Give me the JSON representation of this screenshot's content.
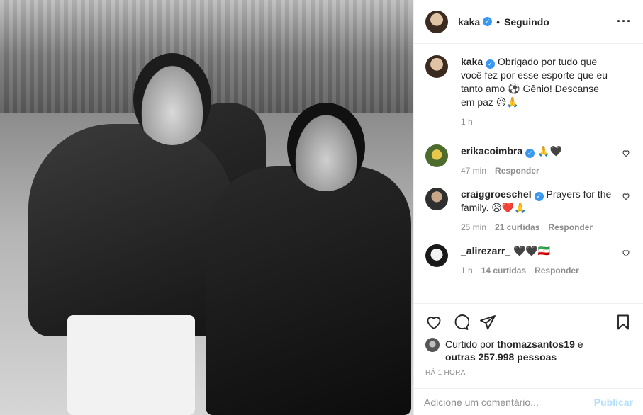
{
  "header": {
    "username": "kaka",
    "separator": "•",
    "follow_status": "Seguindo",
    "more_icon": "more-horizontal-icon"
  },
  "caption": {
    "username": "kaka",
    "text": "Obrigado por tudo que você fez por esse esporte que eu tanto amo ⚽ Gênio! Descanse em paz 😥🙏",
    "time": "1 h"
  },
  "comments": [
    {
      "username": "erikacoimbra",
      "verified": true,
      "text": "🙏🖤",
      "time": "47 min",
      "likes": "",
      "reply": "Responder"
    },
    {
      "username": "craiggroeschel",
      "verified": true,
      "text": "Prayers for the family. 😥❤️🙏",
      "time": "25 min",
      "likes": "21 curtidas",
      "reply": "Responder"
    },
    {
      "username": "_alirezarr_",
      "verified": false,
      "text": "🖤🖤🇮🇷",
      "time": "1 h",
      "likes": "14 curtidas",
      "reply": "Responder"
    }
  ],
  "actions": {
    "like_icon": "heart-icon",
    "comment_icon": "comment-icon",
    "share_icon": "send-icon",
    "save_icon": "bookmark-icon"
  },
  "likes": {
    "prefix": "Curtido por",
    "user": "thomazsantos19",
    "middle": "e",
    "others": "outras 257.998 pessoas"
  },
  "time_ago": "HÁ 1 HORA",
  "add_comment": {
    "placeholder": "Adicione um comentário...",
    "publish": "Publicar"
  },
  "colors": {
    "verified": "#3897f0",
    "publish_disabled": "#b2dffc",
    "muted": "#8e8e8e",
    "text": "#262626"
  }
}
